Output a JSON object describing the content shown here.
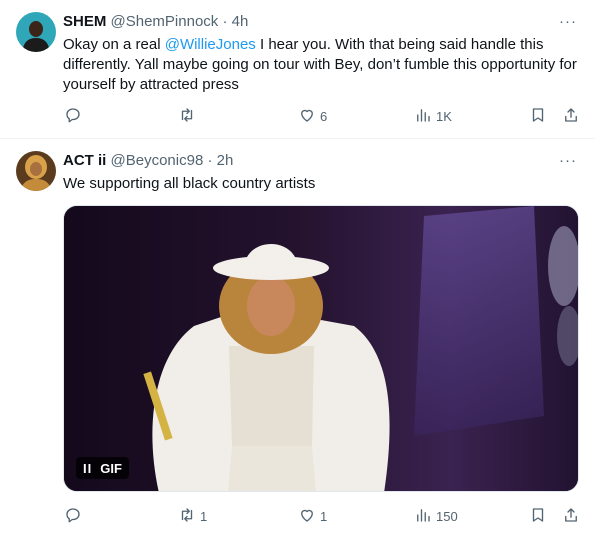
{
  "tweets": [
    {
      "name": "SHEM",
      "handle": "@ShemPinnock",
      "separator": "·",
      "time": "4h",
      "text_before": "Okay on a real ",
      "mention": "@WillieJones",
      "text_after": " I hear you. With that being said handle this differently. Yall maybe going on tour with Bey, don’t fumble this opportunity for yourself by attracted press",
      "more": "···",
      "actions": {
        "reply": "",
        "retweet": "",
        "like": "6",
        "views": "1K"
      }
    },
    {
      "name": "ACT ii",
      "handle": "@Beyconic98",
      "separator": "·",
      "time": "2h",
      "text": "We supporting all black country artists",
      "more": "···",
      "media": {
        "badge_pause": "II",
        "badge_label": "GIF"
      },
      "actions": {
        "reply": "",
        "retweet": "1",
        "like": "1",
        "views": "150"
      }
    }
  ],
  "icons": [
    "reply-icon",
    "retweet-icon",
    "like-icon",
    "views-icon",
    "bookmark-icon",
    "share-icon",
    "more-icon"
  ],
  "colors": {
    "text": "#0f1419",
    "secondary": "#536471",
    "link": "#1d9bf0",
    "divider": "#eff3f4"
  }
}
